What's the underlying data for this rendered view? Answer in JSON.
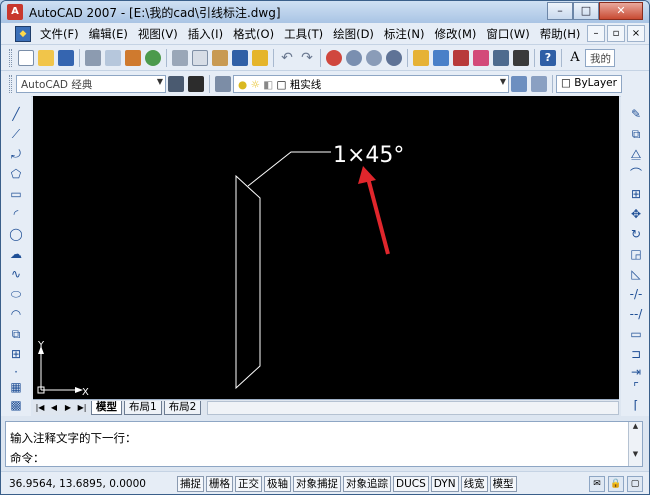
{
  "window": {
    "title": "AutoCAD 2007 - [E:\\我的cad\\引线标注.dwg]",
    "controls": {
      "minimize": "–",
      "maximize": "□",
      "close": "✕"
    }
  },
  "menubar": {
    "items": [
      "文件(F)",
      "编辑(E)",
      "视图(V)",
      "插入(I)",
      "格式(O)",
      "工具(T)",
      "绘图(D)",
      "标注(N)",
      "修改(M)",
      "窗口(W)",
      "帮助(H)"
    ],
    "doc_controls": {
      "minimize": "–",
      "restore": "▫",
      "close": "×"
    }
  },
  "toolbar2": {
    "workspace": "AutoCAD 经典",
    "layer": "粗实线",
    "color": "ByLayer",
    "layer_right_label": "我的"
  },
  "drawing": {
    "annotation_text": "1×45°",
    "ucs_x": "X",
    "ucs_y": "Y",
    "colors": {
      "background": "#000000",
      "lines": "#ffffff",
      "arrow": "#e0262c"
    }
  },
  "layout_tabs": {
    "nav": [
      "|◀",
      "◀",
      "▶",
      "▶|"
    ],
    "tabs": [
      "模型",
      "布局1",
      "布局2"
    ],
    "active": "模型"
  },
  "command": {
    "line1": "输入注释文字的下一行：",
    "line2": "命令："
  },
  "statusbar": {
    "coordinates": "36.9564, 13.6895, 0.0000",
    "buttons": [
      "捕捉",
      "栅格",
      "正交",
      "极轴",
      "对象捕捉",
      "对象追踪",
      "DUCS",
      "DYN",
      "线宽",
      "模型"
    ]
  }
}
